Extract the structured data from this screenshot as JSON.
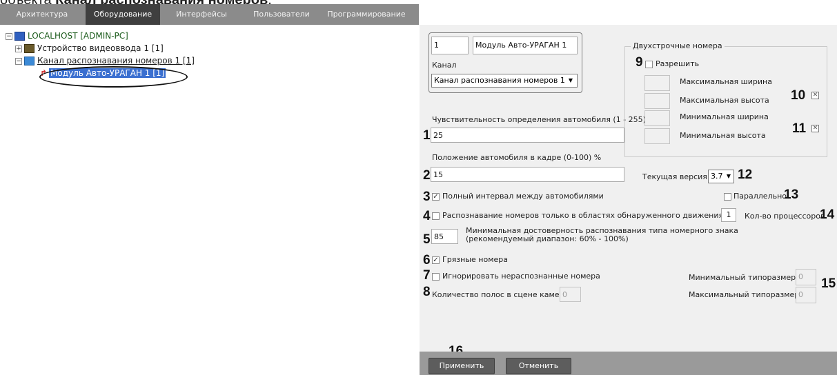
{
  "caption": {
    "prefix": "объекта ",
    "bold": "Канал распознавания номеров",
    "suffix": "."
  },
  "menu": {
    "tabs": [
      "Архитектура",
      "Оборудование",
      "Интерфейсы",
      "Пользователи",
      "Программирование"
    ],
    "active": "Оборудование"
  },
  "tree": {
    "root": "LOCALHOST [ADMIN-PC]",
    "video": "Устройство видеоввода 1 [1]",
    "channel": "Канал распознавания номеров 1 [1]",
    "module": "Модуль Авто-УРАГАН 1 [1]"
  },
  "form": {
    "id_value": "1",
    "name_value": "Модуль Авто-УРАГАН 1",
    "channel_label": "Канал",
    "channel_value": "Канал распознавания номеров 1",
    "sensitivity_label": "Чувствительность определения автомобиля (1 - 255)",
    "sensitivity_value": "25",
    "position_label": "Положение автомобиля в кадре (0-100) %",
    "position_value": "15",
    "full_interval_label": "Полный интервал между автомобилями",
    "motion_only_label": "Распознавание номеров только в областях обнаруженного движения",
    "min_reliability_value": "85",
    "min_reliability_label1": "Минимальная достоверность распознавания типа номерного знака",
    "min_reliability_label2": "(рекомендуемый диапазон: 60% - 100%)",
    "dirty_label": "Грязные номера",
    "ignore_label": "Игнорировать нераспознанные номера",
    "lanes_label": "Количество полос в сцене камеры",
    "lanes_value": "0",
    "two_line_group": "Двухстрочные номера",
    "allow_label": "Разрешить",
    "max_width_label": "Максимальная ширина",
    "max_height_label": "Максимальная высота",
    "min_width_label": "Минимальная ширина",
    "min_height_label": "Минимальная высота",
    "version_label": "Текущая версия:",
    "version_value": "3.7",
    "parallel_label": "Параллельно",
    "cpu_value": "1",
    "cpu_label": "Кол-во процессоров",
    "min_size_label": "Минимальный типоразмер",
    "min_size_value": "0",
    "max_size_label": "Максимальный типоразмер",
    "max_size_value": "0",
    "apply": "Применить",
    "cancel": "Отменить"
  },
  "callouts": [
    "1",
    "2",
    "3",
    "4",
    "5",
    "6",
    "7",
    "8",
    "9",
    "10",
    "11",
    "12",
    "13",
    "14",
    "15",
    "16"
  ]
}
